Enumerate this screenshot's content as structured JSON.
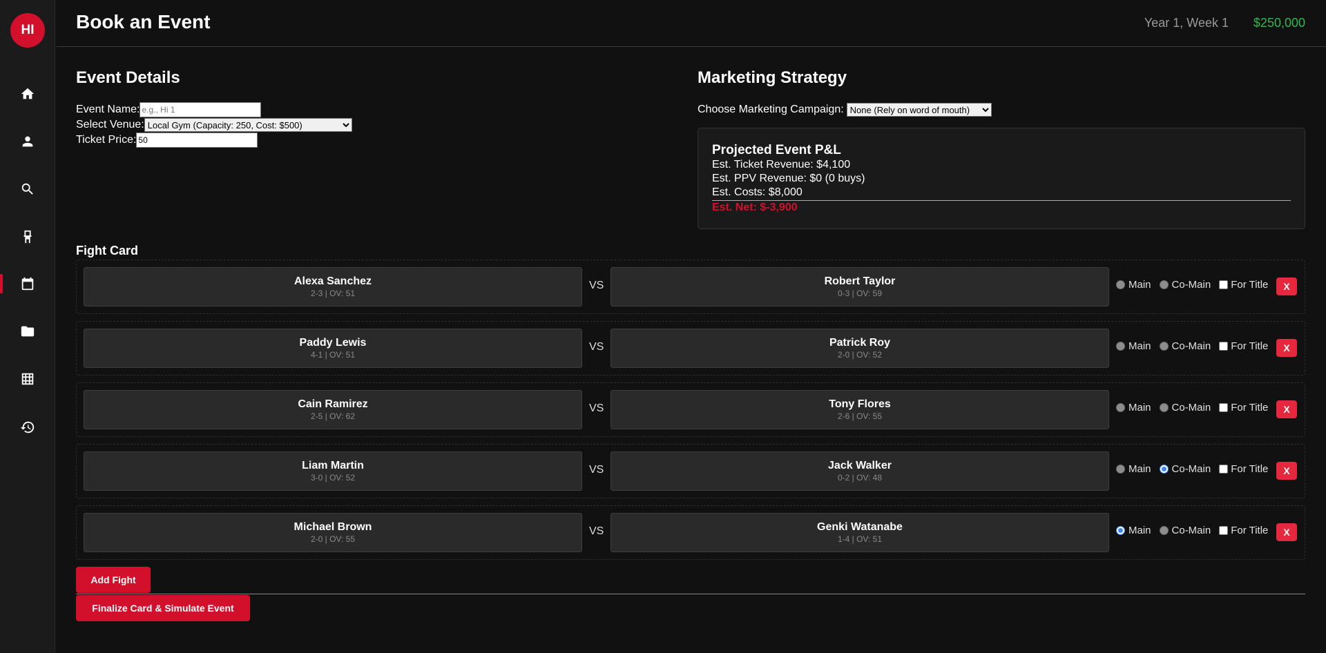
{
  "sidebar": {
    "logo": "HI",
    "items": [
      {
        "icon": "home-icon"
      },
      {
        "icon": "person-icon"
      },
      {
        "icon": "search-icon"
      },
      {
        "icon": "chair-icon"
      },
      {
        "icon": "calendar-icon",
        "active": true
      },
      {
        "icon": "folder-icon"
      },
      {
        "icon": "grid-icon"
      },
      {
        "icon": "history-icon"
      }
    ]
  },
  "header": {
    "title": "Book an Event",
    "date": "Year 1, Week 1",
    "money": "$250,000"
  },
  "event_details": {
    "heading": "Event Details",
    "name_label": "Event Name:",
    "name_placeholder": "e.g., Hi 1",
    "venue_label": "Select Venue:",
    "venue_value": "Local Gym (Capacity: 250, Cost: $500)",
    "price_label": "Ticket Price:",
    "price_value": "50"
  },
  "marketing": {
    "heading": "Marketing Strategy",
    "campaign_label": "Choose Marketing Campaign:",
    "campaign_value": "None (Rely on word of mouth)"
  },
  "pl": {
    "title": "Projected Event P&L",
    "ticket": "Est. Ticket Revenue: $4,100",
    "ppv": "Est. PPV Revenue: $0 (0 buys)",
    "costs": "Est. Costs: $8,000",
    "net": "Est. Net: $-3,900"
  },
  "fight_card": {
    "title": "Fight Card",
    "vs": "VS",
    "main_label": "Main",
    "comain_label": "Co-Main",
    "title_label": "For Title",
    "remove_label": "X",
    "fights": [
      {
        "a": {
          "name": "Alexa Sanchez",
          "rec": "2-3 | OV: 51"
        },
        "b": {
          "name": "Robert Taylor",
          "rec": "0-3 | OV: 59"
        },
        "main": false,
        "comain": false,
        "title": false
      },
      {
        "a": {
          "name": "Paddy Lewis",
          "rec": "4-1 | OV: 51"
        },
        "b": {
          "name": "Patrick Roy",
          "rec": "2-0 | OV: 52"
        },
        "main": false,
        "comain": false,
        "title": false
      },
      {
        "a": {
          "name": "Cain Ramirez",
          "rec": "2-5 | OV: 62"
        },
        "b": {
          "name": "Tony Flores",
          "rec": "2-6 | OV: 55"
        },
        "main": false,
        "comain": false,
        "title": false
      },
      {
        "a": {
          "name": "Liam Martin",
          "rec": "3-0 | OV: 52"
        },
        "b": {
          "name": "Jack Walker",
          "rec": "0-2 | OV: 48"
        },
        "main": false,
        "comain": true,
        "title": false
      },
      {
        "a": {
          "name": "Michael Brown",
          "rec": "2-0 | OV: 55"
        },
        "b": {
          "name": "Genki Watanabe",
          "rec": "1-4 | OV: 51"
        },
        "main": true,
        "comain": false,
        "title": false
      }
    ]
  },
  "buttons": {
    "add_fight": "Add Fight",
    "finalize": "Finalize Card & Simulate Event"
  },
  "colors": {
    "accent": "#d3102b",
    "money": "#2fb84e"
  }
}
